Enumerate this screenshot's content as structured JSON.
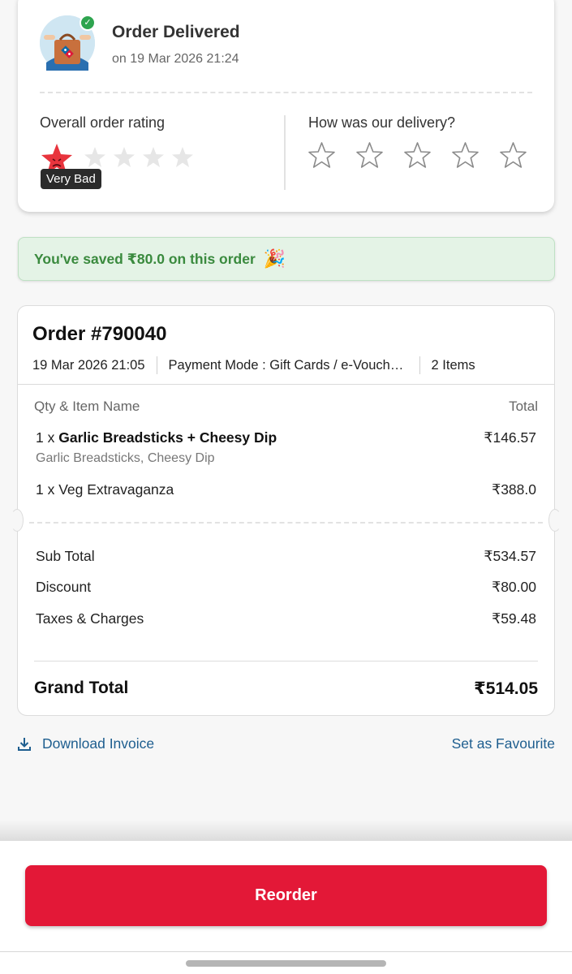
{
  "status": {
    "title": "Order Delivered",
    "date": "on 19 Mar 2026 21:24",
    "icon": "delivery-bag-icon"
  },
  "rating": {
    "overall_label": "Overall order rating",
    "overall_value": 1,
    "overall_max": 5,
    "overall_tooltip": "Very Bad",
    "delivery_label": "How was our delivery?",
    "delivery_value": 0,
    "delivery_max": 5
  },
  "savings": {
    "text": "You've saved ₹80.0 on this order",
    "icon": "party-popper-icon"
  },
  "order": {
    "title": "Order #790040",
    "datetime": "19 Mar 2026 21:05",
    "payment_mode": "Payment Mode :  Gift Cards / e-Vouchers",
    "item_count": "2 Items",
    "col_item": "Qty & Item Name",
    "col_total": "Total",
    "items": [
      {
        "qty": "1 x ",
        "name": "Garlic Breadsticks + Cheesy Dip",
        "sub": "Garlic Breadsticks, Cheesy Dip",
        "price": "₹146.57"
      },
      {
        "qty": "1 x ",
        "name": "Veg Extravaganza",
        "sub": "",
        "price": "₹388.0"
      }
    ],
    "summary": [
      {
        "label": "Sub Total",
        "value": "₹534.57"
      },
      {
        "label": "Discount",
        "value": "₹80.00"
      },
      {
        "label": "Taxes & Charges",
        "value": "₹59.48"
      }
    ],
    "grand_label": "Grand Total",
    "grand_value": "₹514.05"
  },
  "links": {
    "download": "Download Invoice",
    "favourite": "Set as Favourite"
  },
  "reorder_label": "Reorder",
  "colors": {
    "brand_red": "#e31837",
    "savings_green": "#3a8a3e",
    "link_blue": "#1e5e8f"
  }
}
